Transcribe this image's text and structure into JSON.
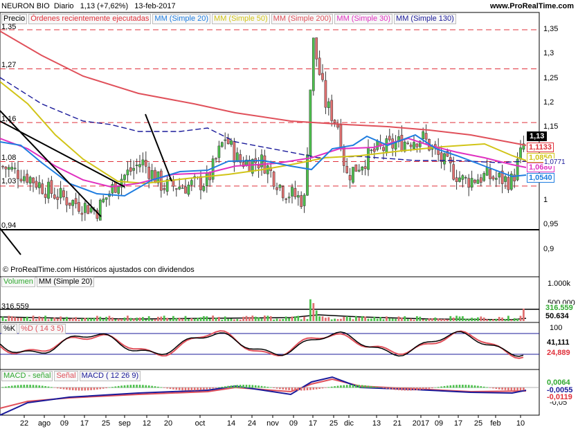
{
  "header": {
    "title": "NEURON BIO",
    "interval": "Diario",
    "last": "1,13 (+7,62%)",
    "date": "13-feb-2017",
    "site": "www.ProRealTime.com"
  },
  "price_panel": {
    "legend": [
      {
        "label": "Precio",
        "color": "#000000"
      },
      {
        "label": "Órdenes recientemente ejecutadas",
        "color": "#e0303a"
      },
      {
        "label": "MM (Simple 20)",
        "color": "#1e7de0"
      },
      {
        "label": "MM (Simple 50)",
        "color": "#d1c417"
      },
      {
        "label": "MM (Simple 200)",
        "color": "#e0505a"
      },
      {
        "label": "MM (Simple 30)",
        "color": "#e030c0"
      },
      {
        "label": "MM (Simple 130)",
        "color": "#1a1a9a"
      }
    ],
    "axis_ticks": [
      "1,35",
      "1,3",
      "1,25",
      "1,2",
      "1,15",
      "1,1",
      "1,05",
      "1",
      "0,95",
      "0,9"
    ],
    "dashed_levels": [
      "1,35",
      "1,27",
      "1,16",
      "1,08",
      "1,03"
    ],
    "solid_level": "0,94",
    "badges": [
      {
        "label": "1,13",
        "color": "#000000",
        "bg": "#ffffff"
      },
      {
        "label": "1,1133",
        "color": "#e0303a",
        "bg": "#ffffff"
      },
      {
        "label": "1,0850",
        "color": "#d1c417",
        "bg": "#ffffff"
      },
      {
        "label": "1,0680",
        "color": "#e030c0",
        "bg": "#ffffff"
      },
      {
        "label": "1,0540",
        "color": "#1e7de0",
        "bg": "#ffffff"
      }
    ],
    "hidden_badge": "1,0771",
    "footnote": "© ProRealTime.com Históricos ajustados con dividendos"
  },
  "volume_panel": {
    "legend": [
      {
        "label": "Volumen",
        "color": "#2fa82f"
      },
      {
        "label": "MM (Simple 20)",
        "color": "#000000"
      }
    ],
    "axis_ticks": [
      "1.000k",
      "500.000"
    ],
    "level_label": "316.559",
    "badges": [
      {
        "label": "316.559",
        "color": "#2fa82f"
      },
      {
        "label": "50.634",
        "color": "#000000"
      }
    ]
  },
  "stoch_panel": {
    "legend": [
      {
        "label": "%K",
        "color": "#000000"
      },
      {
        "label": "%D ( 14 3 5)",
        "color": "#e0505a"
      }
    ],
    "axis_ticks": [
      "100",
      "0"
    ],
    "badges": [
      {
        "label": "41,111",
        "color": "#000000"
      },
      {
        "label": "24,889",
        "color": "#e0303a"
      }
    ]
  },
  "macd_panel": {
    "legend": [
      {
        "label": "MACD - señal",
        "color": "#2fa82f"
      },
      {
        "label": "Señal",
        "color": "#e0505a"
      },
      {
        "label": "MACD ( 12 26 9)",
        "color": "#1a1a9a"
      }
    ],
    "axis_ticks": [
      "0",
      "-0,05"
    ],
    "badges": [
      {
        "label": "0,0064",
        "color": "#2fa82f"
      },
      {
        "label": "-0,0055",
        "color": "#1a1a9a"
      },
      {
        "label": "-0,0119",
        "color": "#e0303a"
      }
    ]
  },
  "x_axis": [
    "22",
    "ago",
    "09",
    "17",
    "25",
    "sep",
    "12",
    "20",
    "oct",
    "14",
    "24",
    "nov",
    "09",
    "17",
    "25",
    "dic",
    "13",
    "21",
    "2017",
    "09",
    "17",
    "25",
    "feb",
    "10"
  ],
  "chart_data": {
    "type": "line",
    "title": "NEURON BIO",
    "ylim": [
      0.88,
      1.36
    ],
    "series": [
      {
        "name": "MM (Simple 200)",
        "values": [
          1.33,
          1.31,
          1.29,
          1.27,
          1.25,
          1.23,
          1.21,
          1.2,
          1.19,
          1.18,
          1.17,
          1.16,
          1.15,
          1.14,
          1.13,
          1.12
        ]
      },
      {
        "name": "MM (Simple 20)",
        "values": [
          1.06,
          1.05,
          1.03,
          1.01,
          1.01,
          1.04,
          1.04,
          1.04,
          1.05,
          1.06,
          1.09,
          1.1,
          1.08,
          1.06,
          1.06,
          1.05
        ]
      },
      {
        "name": "MM (Simple 50)",
        "values": [
          1.26,
          1.17,
          1.1,
          1.05,
          1.04,
          1.04,
          1.05,
          1.05,
          1.06,
          1.08,
          1.09,
          1.09,
          1.09,
          1.1,
          1.1,
          1.09
        ]
      }
    ]
  }
}
